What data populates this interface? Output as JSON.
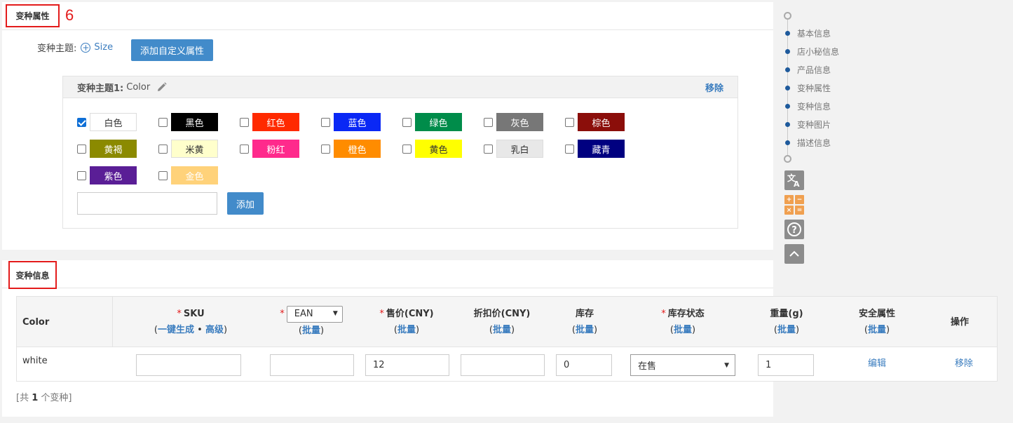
{
  "attr_panel": {
    "title": "变种属性",
    "badge": "6",
    "theme_label": "变种主题:",
    "size_link": "Size",
    "add_custom_btn": "添加自定义属性",
    "variant_box": {
      "title": "变种主题1:",
      "name": "Color",
      "remove": "移除",
      "colors": [
        {
          "label": "白色",
          "bg": "#ffffff",
          "fg": "#333333",
          "checked": true
        },
        {
          "label": "黑色",
          "bg": "#000000",
          "fg": "#ffffff",
          "checked": false
        },
        {
          "label": "红色",
          "bg": "#ff2a00",
          "fg": "#ffffff",
          "checked": false
        },
        {
          "label": "蓝色",
          "bg": "#0a28f5",
          "fg": "#ffffff",
          "checked": false
        },
        {
          "label": "绿色",
          "bg": "#008c4a",
          "fg": "#ffffff",
          "checked": false
        },
        {
          "label": "灰色",
          "bg": "#777777",
          "fg": "#ffffff",
          "checked": false
        },
        {
          "label": "棕色",
          "bg": "#8b0e0a",
          "fg": "#ffffff",
          "checked": false
        },
        {
          "label": "黄褐",
          "bg": "#8b8a00",
          "fg": "#ffffff",
          "checked": false
        },
        {
          "label": "米黄",
          "bg": "#ffffcc",
          "fg": "#333333",
          "checked": false
        },
        {
          "label": "粉红",
          "bg": "#ff2a8c",
          "fg": "#ffffff",
          "checked": false
        },
        {
          "label": "橙色",
          "bg": "#ff8c00",
          "fg": "#ffffff",
          "checked": false
        },
        {
          "label": "黄色",
          "bg": "#ffff00",
          "fg": "#333333",
          "checked": false
        },
        {
          "label": "乳白",
          "bg": "#e8e8e8",
          "fg": "#333333",
          "checked": false
        },
        {
          "label": "藏青",
          "bg": "#000080",
          "fg": "#ffffff",
          "checked": false
        },
        {
          "label": "紫色",
          "bg": "#5a1e96",
          "fg": "#ffffff",
          "checked": false
        },
        {
          "label": "金色",
          "bg": "#ffd27a",
          "fg": "#ffffff",
          "checked": false
        }
      ],
      "add_btn": "添加"
    }
  },
  "info_panel": {
    "title": "变种信息",
    "headers": {
      "color": "Color",
      "sku": "SKU",
      "sku_gen": "一键生成",
      "sku_sep": "•",
      "sku_adv": "高级",
      "ean": "EAN",
      "price": "售价(CNY)",
      "discount": "折扣价(CNY)",
      "stock": "库存",
      "stock_status": "库存状态",
      "weight": "重量(g)",
      "safety": "安全属性",
      "action": "操作",
      "batch": "批量",
      "req": "*"
    },
    "row": {
      "color": "white",
      "sku": "",
      "ean": "",
      "price": "12",
      "discount": "",
      "stock": "0",
      "stock_status": "在售",
      "weight": "1",
      "edit": "编辑",
      "remove": "移除"
    },
    "footer": {
      "prefix": "[共",
      "count": "1",
      "suffix": "个变种]"
    }
  },
  "side_nav": {
    "items": [
      "基本信息",
      "店小秘信息",
      "产品信息",
      "变种属性",
      "变种信息",
      "变种图片",
      "描述信息"
    ],
    "tools": [
      "translate-icon",
      "calculator-icon",
      "help-icon",
      "back-to-top-icon"
    ]
  }
}
